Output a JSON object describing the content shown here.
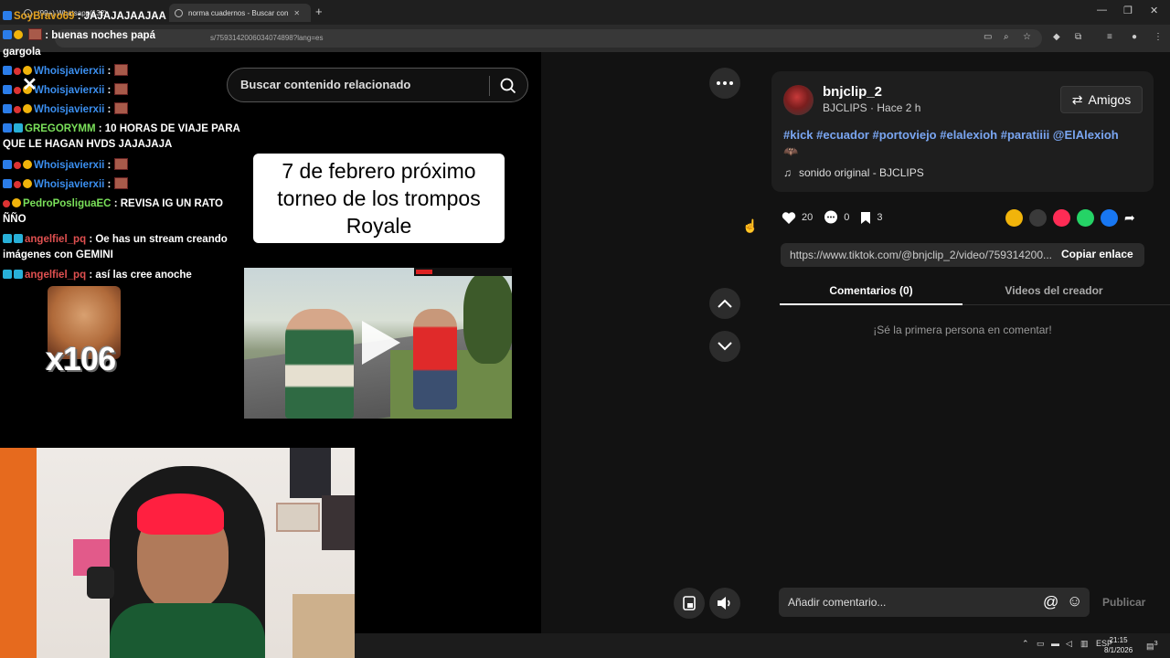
{
  "browser": {
    "tabs": [
      {
        "label": "(99+) Whatsapp(132)"
      },
      {
        "label": "norma cuadernos - Buscar con"
      }
    ],
    "url": "s/7593142006034074898?lang=es"
  },
  "chat": {
    "lines": [
      {
        "user": "SoyBravo69",
        "text": ": JAJAJAJAAJAA"
      },
      {
        "user": "",
        "text": ": buenas noches papá"
      },
      {
        "user": "",
        "text": "gargola"
      },
      {
        "user": "Whoisjavierxii",
        "text": ":"
      },
      {
        "user": "Whoisjavierxii",
        "text": ":"
      },
      {
        "user": "Whoisjavierxii",
        "text": ":"
      },
      {
        "user": "GREGORYMM",
        "text": ": 10 HORAS DE VIAJE PARA QUE LE HAGAN HVDS JAJAJAJA"
      },
      {
        "user": "Whoisjavierxii",
        "text": ":"
      },
      {
        "user": "Whoisjavierxii",
        "text": ":"
      },
      {
        "user": "PedroPosliguaEC",
        "text": ": REVISA IG UN RATO ÑÑO"
      },
      {
        "user": "angelfiel_pq",
        "text": ": Oe has un stream creando imágenes con GEMINI"
      },
      {
        "user": "angelfiel_pq",
        "text": ": así las cree anoche"
      }
    ],
    "emote_count": "x106"
  },
  "video": {
    "search_placeholder": "Buscar contenido relacionado",
    "caption": "7 de febrero próximo torneo de los trompos Royale"
  },
  "post": {
    "username": "bnjclip_2",
    "meta": "BJCLIPS · Hace 2 h",
    "friends_label": "Amigos",
    "tags": "#kick #ecuador #portoviejo #elalexioh #paratiiii @ElAlexioh",
    "sound": "sonido original - BJCLIPS",
    "likes": "20",
    "comments": "0",
    "saves": "3",
    "link": "https://www.tiktok.com/@bnjclip_2/video/759314200...",
    "copy_label": "Copiar enlace",
    "tab_comments": "Comentarios (0)",
    "tab_videos": "Videos del creador",
    "empty_comments": "¡Sé la primera persona en comentar!",
    "comment_placeholder": "Añadir comentario...",
    "publish_label": "Publicar"
  },
  "taskbar": {
    "lang": "ESP",
    "time": "21:15",
    "date": "8/1/2026",
    "notif": "3"
  },
  "colors": {
    "accent_link": "#7aa6f2",
    "background": "#121212",
    "share_colors": [
      "#f1b40b",
      "#3a3a3a",
      "#fe2c55",
      "#25d366",
      "#1877f2"
    ]
  }
}
